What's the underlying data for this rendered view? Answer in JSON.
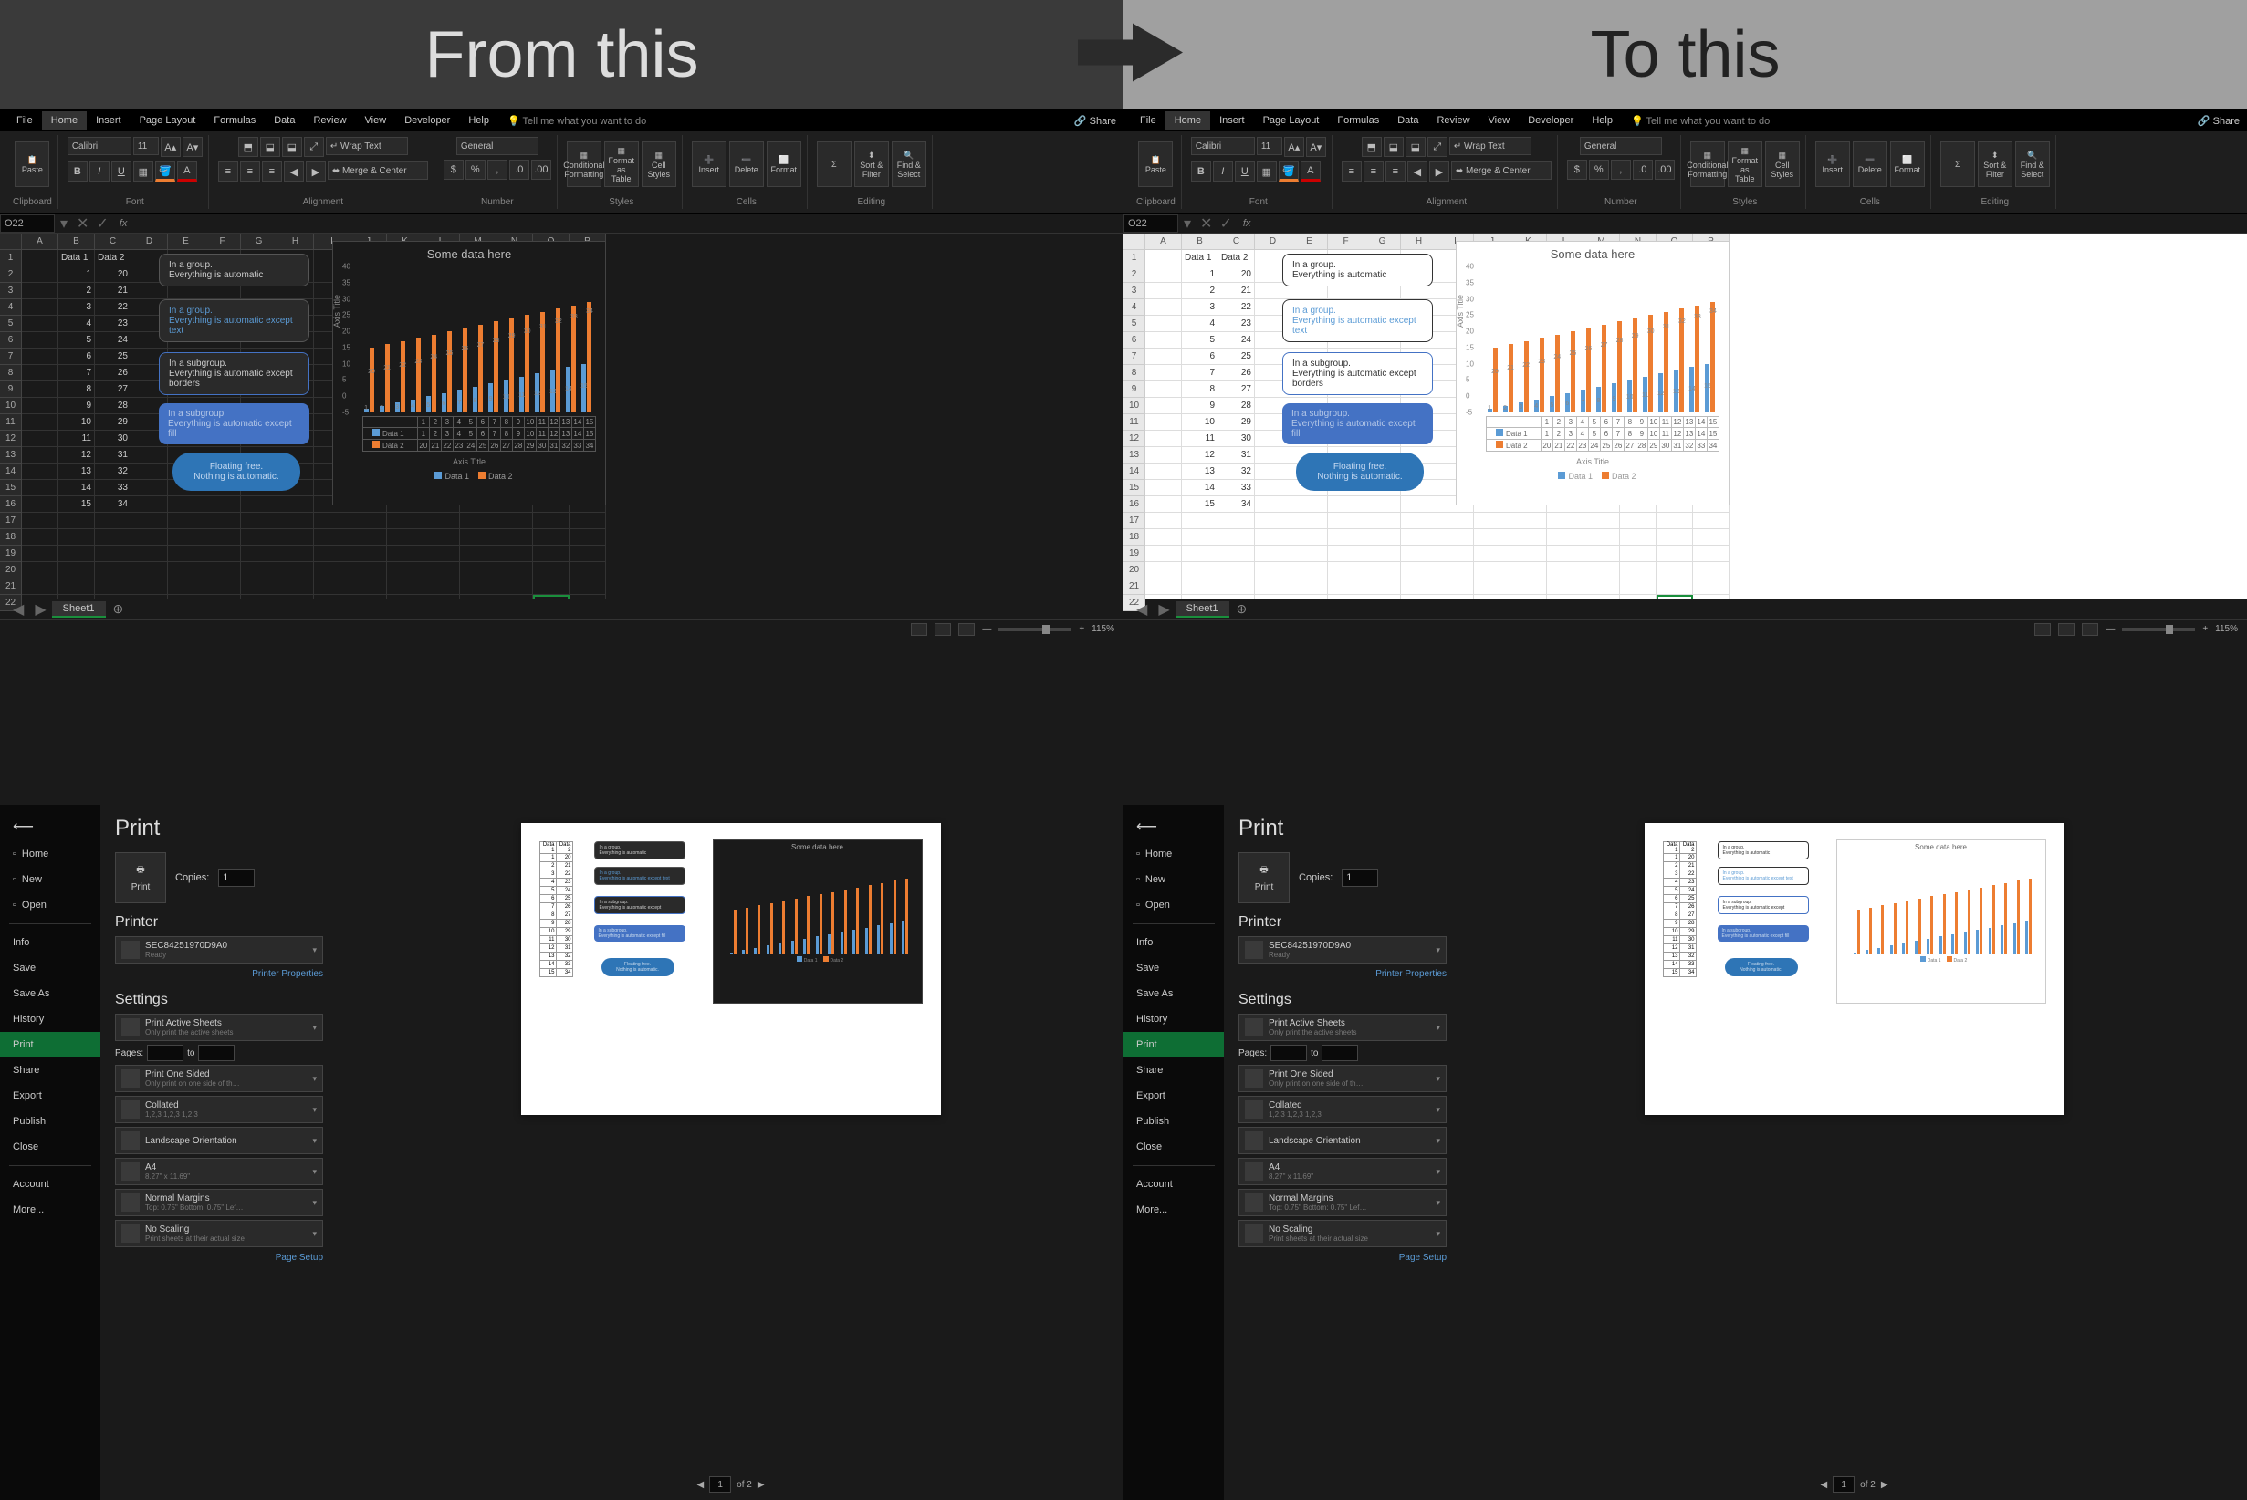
{
  "header": {
    "left": "From this",
    "right": "To this"
  },
  "excel": {
    "tabs": [
      "File",
      "Home",
      "Insert",
      "Page Layout",
      "Formulas",
      "Data",
      "Review",
      "View",
      "Developer",
      "Help"
    ],
    "tellme": "Tell me what you want to do",
    "share": "Share",
    "ribbon_groups": {
      "clipboard": "Clipboard",
      "font": "Font",
      "alignment": "Alignment",
      "number": "Number",
      "styles": "Styles",
      "cells": "Cells",
      "editing": "Editing"
    },
    "ribbon": {
      "paste": "Paste",
      "font_name": "Calibri",
      "font_size": "11",
      "wrap": "Wrap Text",
      "merge": "Merge & Center",
      "num_fmt": "General",
      "cond_fmt": "Conditional Formatting",
      "fmt_table": "Format as Table",
      "cell_styles": "Cell Styles",
      "insert": "Insert",
      "delete": "Delete",
      "format": "Format",
      "sort": "Sort & Filter",
      "find": "Find & Select"
    },
    "namebox": "O22",
    "col_headers": [
      "A",
      "B",
      "C",
      "D",
      "E",
      "F",
      "G",
      "H",
      "I",
      "J",
      "K",
      "L",
      "M",
      "N",
      "O",
      "P"
    ],
    "data_headers": [
      "Data 1",
      "Data 2"
    ],
    "rows": [
      [
        1,
        20
      ],
      [
        2,
        21
      ],
      [
        3,
        22
      ],
      [
        4,
        23
      ],
      [
        5,
        24
      ],
      [
        6,
        25
      ],
      [
        7,
        26
      ],
      [
        8,
        27
      ],
      [
        9,
        28
      ],
      [
        10,
        29
      ],
      [
        11,
        30
      ],
      [
        12,
        31
      ],
      [
        13,
        32
      ],
      [
        14,
        33
      ],
      [
        15,
        34
      ]
    ],
    "callouts": {
      "c1": "In a group.\nEverything is automatic",
      "c2": "In a group.\nEverything is automatic except text",
      "c3": "In a subgroup.\nEverything is automatic except borders",
      "c4": "In a subgroup.\nEverything is automatic except fill",
      "c5": "Floating free.\nNothing is automatic."
    },
    "sheet": "Sheet1",
    "zoom": "115%"
  },
  "chart_data": {
    "type": "bar",
    "title": "Some data here",
    "xlabel": "Axis Title",
    "ylabel": "Axis Title",
    "ylim": [
      -5,
      40
    ],
    "yticks": [
      -5,
      0,
      5,
      10,
      15,
      20,
      25,
      30,
      35,
      40
    ],
    "categories": [
      1,
      2,
      3,
      4,
      5,
      6,
      7,
      8,
      9,
      10,
      11,
      12,
      13,
      14,
      15
    ],
    "series": [
      {
        "name": "Data 1",
        "values": [
          1,
          2,
          3,
          4,
          5,
          6,
          7,
          8,
          9,
          10,
          11,
          12,
          13,
          14,
          15
        ],
        "color": "#5b9bd5"
      },
      {
        "name": "Data 2",
        "values": [
          20,
          21,
          22,
          23,
          24,
          25,
          26,
          27,
          28,
          29,
          30,
          31,
          32,
          33,
          34
        ],
        "color": "#ed7d31"
      }
    ]
  },
  "print": {
    "title": "Print",
    "copies_label": "Copies:",
    "copies": "1",
    "print_btn": "Print",
    "printer_h": "Printer",
    "printer_name": "SEC84251970D9A0",
    "printer_status": "Ready",
    "printer_props": "Printer Properties",
    "settings_h": "Settings",
    "s_active": "Print Active Sheets",
    "s_active_sub": "Only print the active sheets",
    "pages": "Pages:",
    "to": "to",
    "s_oneside": "Print One Sided",
    "s_oneside_sub": "Only print on one side of th…",
    "s_collated": "Collated",
    "s_collated_sub": "1,2,3   1,2,3   1,2,3",
    "s_orient": "Landscape Orientation",
    "s_paper": "A4",
    "s_paper_sub": "8.27\" x 11.69\"",
    "s_margins": "Normal Margins",
    "s_margins_sub": "Top: 0.75\" Bottom: 0.75\" Lef…",
    "s_scale": "No Scaling",
    "s_scale_sub": "Print sheets at their actual size",
    "page_setup": "Page Setup",
    "nav": {
      "current": "1",
      "of": "of",
      "total": "2"
    }
  },
  "backstage_nav": {
    "home": "Home",
    "new": "New",
    "open": "Open",
    "info": "Info",
    "save": "Save",
    "saveas": "Save As",
    "history": "History",
    "print": "Print",
    "share": "Share",
    "export": "Export",
    "publish": "Publish",
    "close": "Close",
    "account": "Account",
    "more": "More..."
  }
}
